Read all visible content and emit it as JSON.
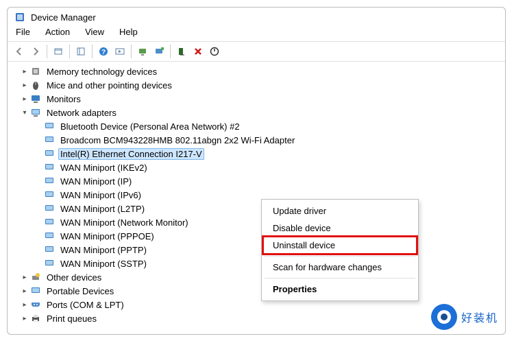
{
  "window": {
    "title": "Device Manager"
  },
  "menubar": {
    "file": "File",
    "action": "Action",
    "view": "View",
    "help": "Help"
  },
  "tree": {
    "memtech": "Memory technology devices",
    "mice": "Mice and other pointing devices",
    "monitors": "Monitors",
    "network": "Network adapters",
    "na0": "Bluetooth Device (Personal Area Network) #2",
    "na1": "Broadcom BCM943228HMB 802.11abgn 2x2 Wi-Fi Adapter",
    "na2": "Intel(R) Ethernet Connection I217-V",
    "na3": "WAN Miniport (IKEv2)",
    "na4": "WAN Miniport (IP)",
    "na5": "WAN Miniport (IPv6)",
    "na6": "WAN Miniport (L2TP)",
    "na7": "WAN Miniport (Network Monitor)",
    "na8": "WAN Miniport (PPPOE)",
    "na9": "WAN Miniport (PPTP)",
    "na10": "WAN Miniport (SSTP)",
    "other": "Other devices",
    "portable": "Portable Devices",
    "ports": "Ports (COM & LPT)",
    "printq": "Print queues"
  },
  "context": {
    "update": "Update driver",
    "disable": "Disable device",
    "uninstall": "Uninstall device",
    "scan": "Scan for hardware changes",
    "properties": "Properties"
  },
  "watermark": {
    "text": "好装机"
  },
  "colors": {
    "highlight_red": "#e10f0f",
    "selection_bg": "#cde6ff"
  }
}
